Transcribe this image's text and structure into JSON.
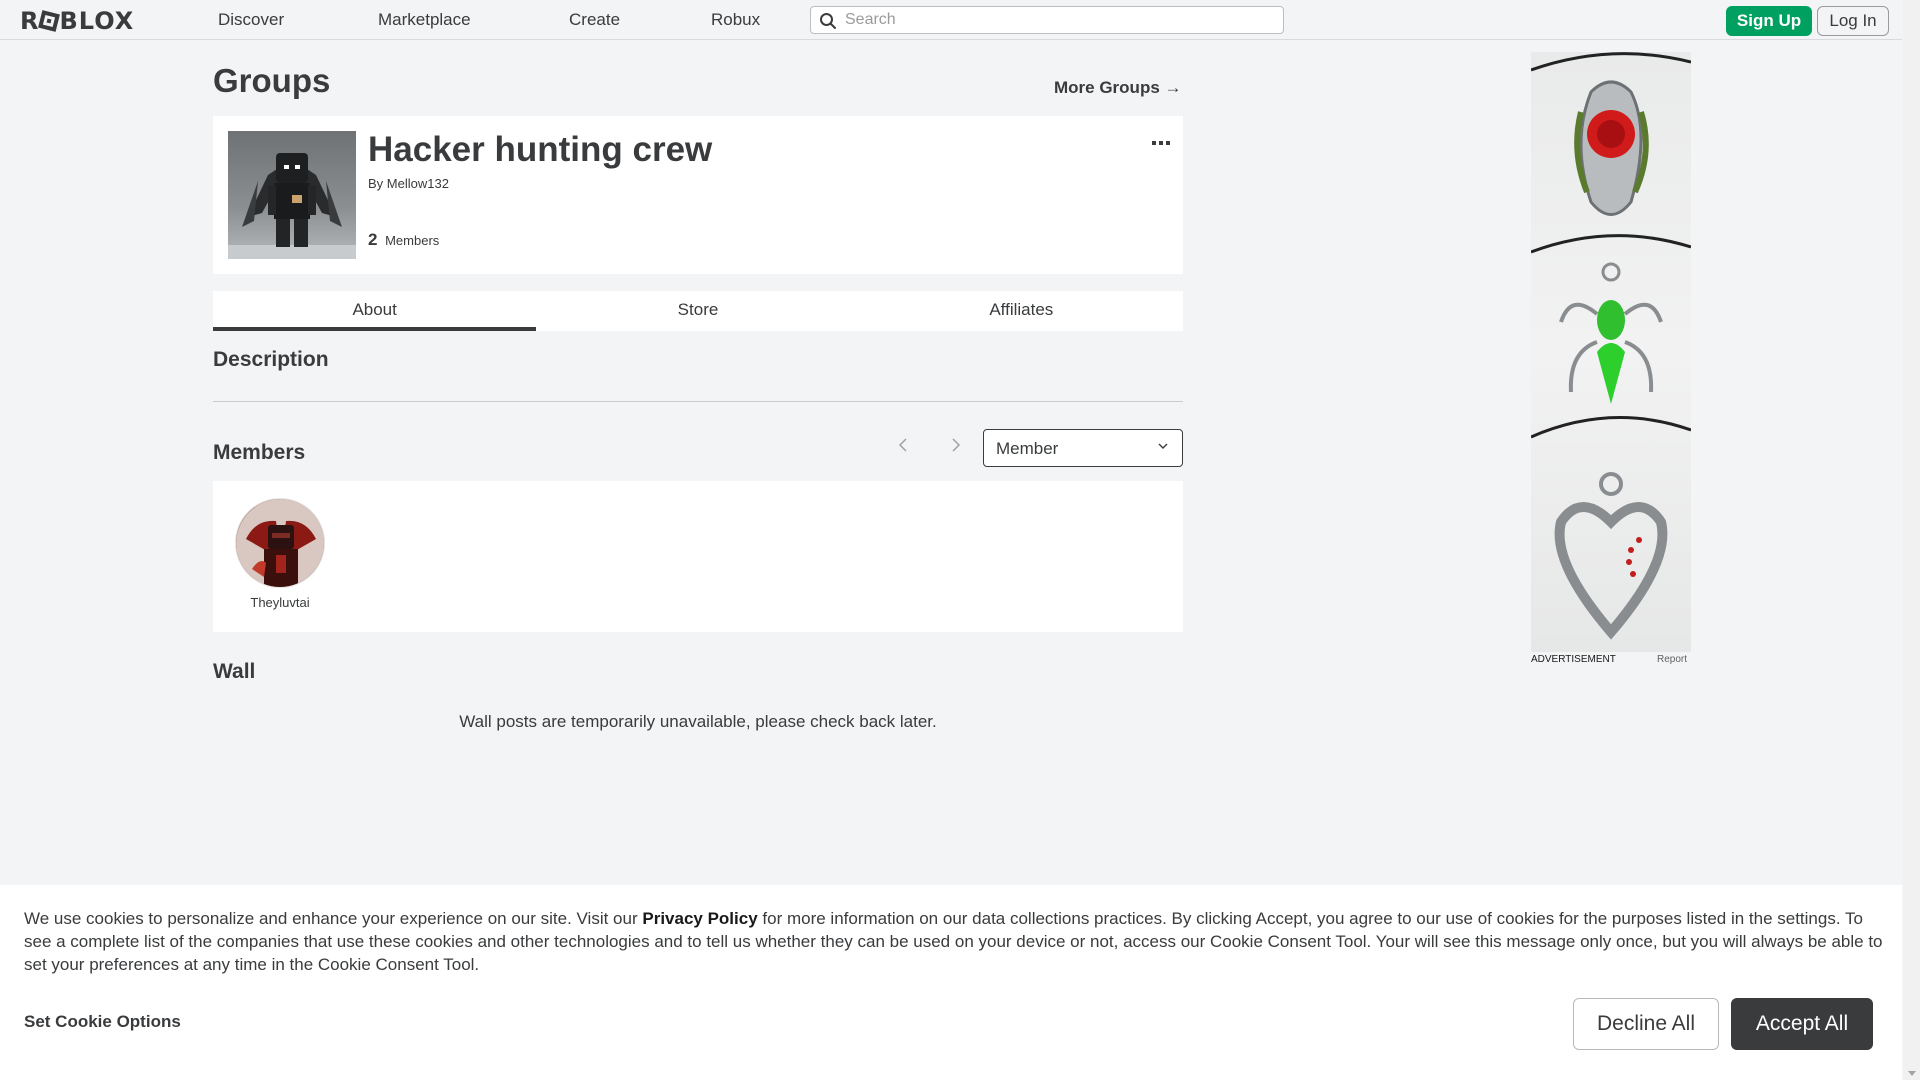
{
  "nav": {
    "logo": "ROBLOX",
    "links": [
      "Discover",
      "Marketplace",
      "Create",
      "Robux"
    ],
    "search_placeholder": "Search",
    "signup_label": "Sign Up",
    "login_label": "Log In"
  },
  "page": {
    "title": "Groups",
    "more_groups": "More Groups →"
  },
  "group": {
    "name": "Hacker hunting crew",
    "by_label": "By",
    "owner": "Mellow132",
    "member_count": "2",
    "members_label": "Members",
    "menu_icon": "more-dots-icon"
  },
  "tabs": [
    {
      "label": "About",
      "active": true
    },
    {
      "label": "Store",
      "active": false
    },
    {
      "label": "Affiliates",
      "active": false
    }
  ],
  "sections": {
    "description": "Description",
    "members": "Members",
    "wall": "Wall"
  },
  "members": {
    "role_selected": "Member",
    "list": [
      {
        "name": "Theyluvtai"
      }
    ]
  },
  "wall": {
    "message": "Wall posts are temporarily unavailable, please check back later."
  },
  "ad": {
    "label": "ADVERTISEMENT",
    "report": "Report"
  },
  "cookie": {
    "text_before": "We use cookies to personalize and enhance your experience on our site. Visit our ",
    "privacy_link": "Privacy Policy",
    "text_after": " for more information on our data collections practices. By clicking Accept, you agree to our use of cookies for the purposes listed in the settings. To see a complete list of the companies that use these cookies and other technologies and to tell us whether they can be used on your device or not, access our Cookie Consent Tool. Your will see this message only once, but you will always be able to set your preferences at any time in the Cookie Consent Tool.",
    "set_options": "Set Cookie Options",
    "decline": "Decline All",
    "accept": "Accept All"
  },
  "colors": {
    "accent_green": "#00a060",
    "text_dark": "#393b3d",
    "page_bg": "#f2f4f5"
  }
}
